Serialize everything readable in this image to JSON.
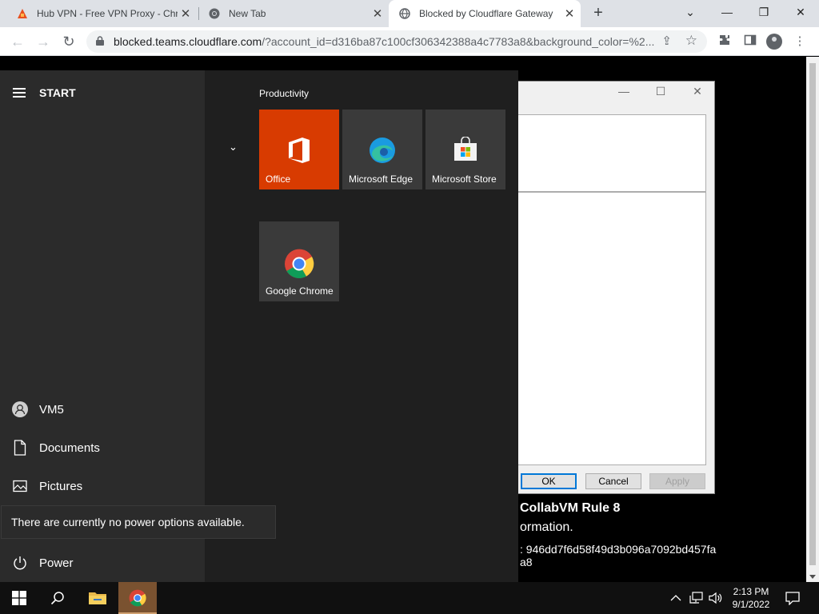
{
  "browser": {
    "tabs": [
      {
        "title": "Hub VPN - Free VPN Proxy - Chr",
        "favicon": "hubvpn-icon",
        "active": false
      },
      {
        "title": "New Tab",
        "favicon": "chrome-icon",
        "active": false
      },
      {
        "title": "Blocked by Cloudflare Gateway",
        "favicon": "globe-icon",
        "active": true
      }
    ],
    "new_tab_label": "+",
    "window_controls": {
      "minimize": "⌄",
      "restore": "—",
      "maximize": "❐",
      "close": "✕"
    },
    "url_host": "blocked.teams.cloudflare.com",
    "url_rest": "/?account_id=d316ba87c100cf306342388a4c7783a8&background_color=%2..."
  },
  "page": {
    "rule_text": "CollabVM Rule 8",
    "info_text": "ormation.",
    "id_line1": ": 946dd7f6d58f49d3b096a7092bd457fa",
    "id_line2": "a8"
  },
  "dialog": {
    "ok": "OK",
    "cancel": "Cancel",
    "apply": "Apply"
  },
  "start_menu": {
    "header": "START",
    "group_label": "Productivity",
    "tiles": [
      {
        "label": "Office",
        "color": "#d83b01"
      },
      {
        "label": "Microsoft Edge",
        "color": "#3a3a3a"
      },
      {
        "label": "Microsoft Store",
        "color": "#3a3a3a"
      },
      {
        "label": "Google Chrome",
        "color": "#3a3a3a"
      }
    ],
    "left_items": [
      {
        "label": "VM5",
        "icon": "user-icon"
      },
      {
        "label": "Documents",
        "icon": "document-icon"
      },
      {
        "label": "Pictures",
        "icon": "pictures-icon"
      },
      {
        "label": "Power",
        "icon": "power-icon"
      }
    ],
    "tooltip": "There are currently no power options available."
  },
  "taskbar": {
    "time": "2:13 PM",
    "date": "9/1/2022"
  }
}
